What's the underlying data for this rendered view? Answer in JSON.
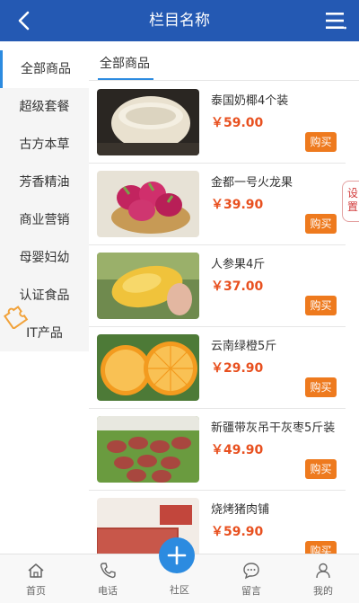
{
  "header": {
    "title": "栏目名称"
  },
  "sidebar": {
    "items": [
      {
        "label": "全部商品"
      },
      {
        "label": "超级套餐"
      },
      {
        "label": "古方本草"
      },
      {
        "label": "芳香精油"
      },
      {
        "label": "商业营销"
      },
      {
        "label": "母婴妇幼"
      },
      {
        "label": "认证食品"
      },
      {
        "label": "IT产品"
      }
    ]
  },
  "content": {
    "tab_label": "全部商品",
    "buy_label": "购买",
    "products": [
      {
        "name": "泰国奶椰4个装",
        "price": "￥59.00",
        "image": "coconut"
      },
      {
        "name": "金都一号火龙果",
        "price": "￥39.90",
        "image": "dragon-fruit"
      },
      {
        "name": "人参果4斤",
        "price": "￥37.00",
        "image": "ginseng-fruit"
      },
      {
        "name": "云南绿橙5斤",
        "price": "￥29.90",
        "image": "orange"
      },
      {
        "name": "新疆带灰吊干灰枣5斤装",
        "price": "￥49.90",
        "image": "jujube"
      },
      {
        "name": "烧烤猪肉铺",
        "price": "￥59.90",
        "image": "pork-jerky"
      }
    ]
  },
  "floating": {
    "settings_label_1": "设",
    "settings_label_2": "置"
  },
  "tabbar": {
    "items": [
      {
        "label": "首页",
        "icon": "home-icon"
      },
      {
        "label": "电话",
        "icon": "phone-icon"
      },
      {
        "label": "社区",
        "icon": "plus-icon"
      },
      {
        "label": "留言",
        "icon": "chat-icon"
      },
      {
        "label": "我的",
        "icon": "user-icon"
      }
    ]
  },
  "colors": {
    "header": "#2459b3",
    "accent": "#2c8be0",
    "price": "#e8501f",
    "buy_button": "#ee7a1e"
  }
}
